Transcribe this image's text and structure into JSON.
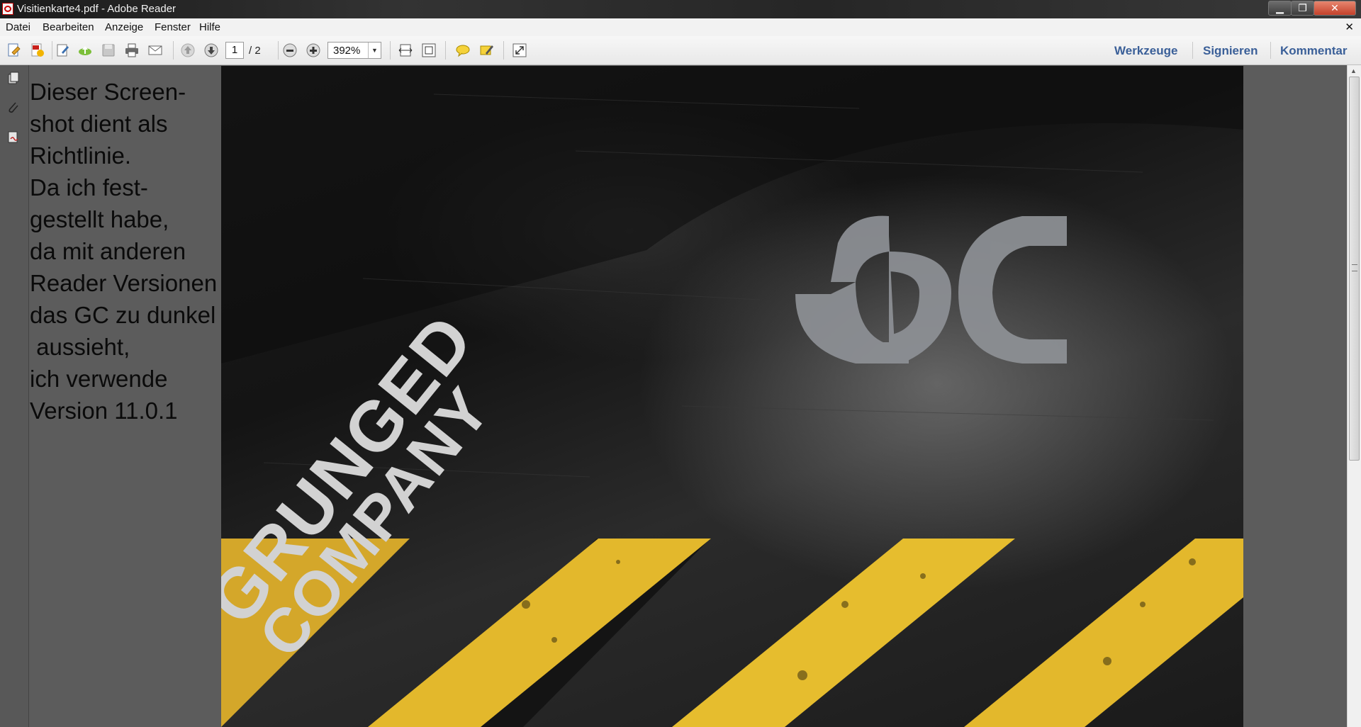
{
  "window": {
    "title": "Visitienkarte4.pdf - Adobe Reader",
    "minimize_glyph": "▁",
    "maximize_glyph": "❐",
    "close_glyph": "✕"
  },
  "menu": {
    "items": [
      "Datei",
      "Bearbeiten",
      "Anzeige",
      "Fenster",
      "Hilfe"
    ],
    "close_glyph": "✕"
  },
  "toolbar": {
    "page_current": "1",
    "page_total": "/ 2",
    "zoom": "392%",
    "zoom_drop_glyph": "▼",
    "links": [
      "Werkzeuge",
      "Signieren",
      "Kommentar"
    ],
    "link_color": "#3a5f98"
  },
  "nav_icons": [
    "pages-icon",
    "attachment-icon",
    "signature-icon"
  ],
  "note": {
    "lines": [
      "Dieser Screen-",
      "shot dient als",
      "Richtlinie.",
      "Da ich fest-",
      "gestellt habe,",
      "da mit anderen",
      "Reader Versionen",
      "das GC zu dunkel",
      " aussieht,",
      "ich verwende",
      "Version 11.0.1"
    ]
  },
  "document": {
    "logo_text": "GC",
    "brand_line1": "GRUNGED",
    "brand_line2": "COMPANY",
    "stripe_color": "#e3b82c",
    "background_color": "#1a1a1a"
  },
  "scrollbar": {
    "up_glyph": "▲"
  }
}
